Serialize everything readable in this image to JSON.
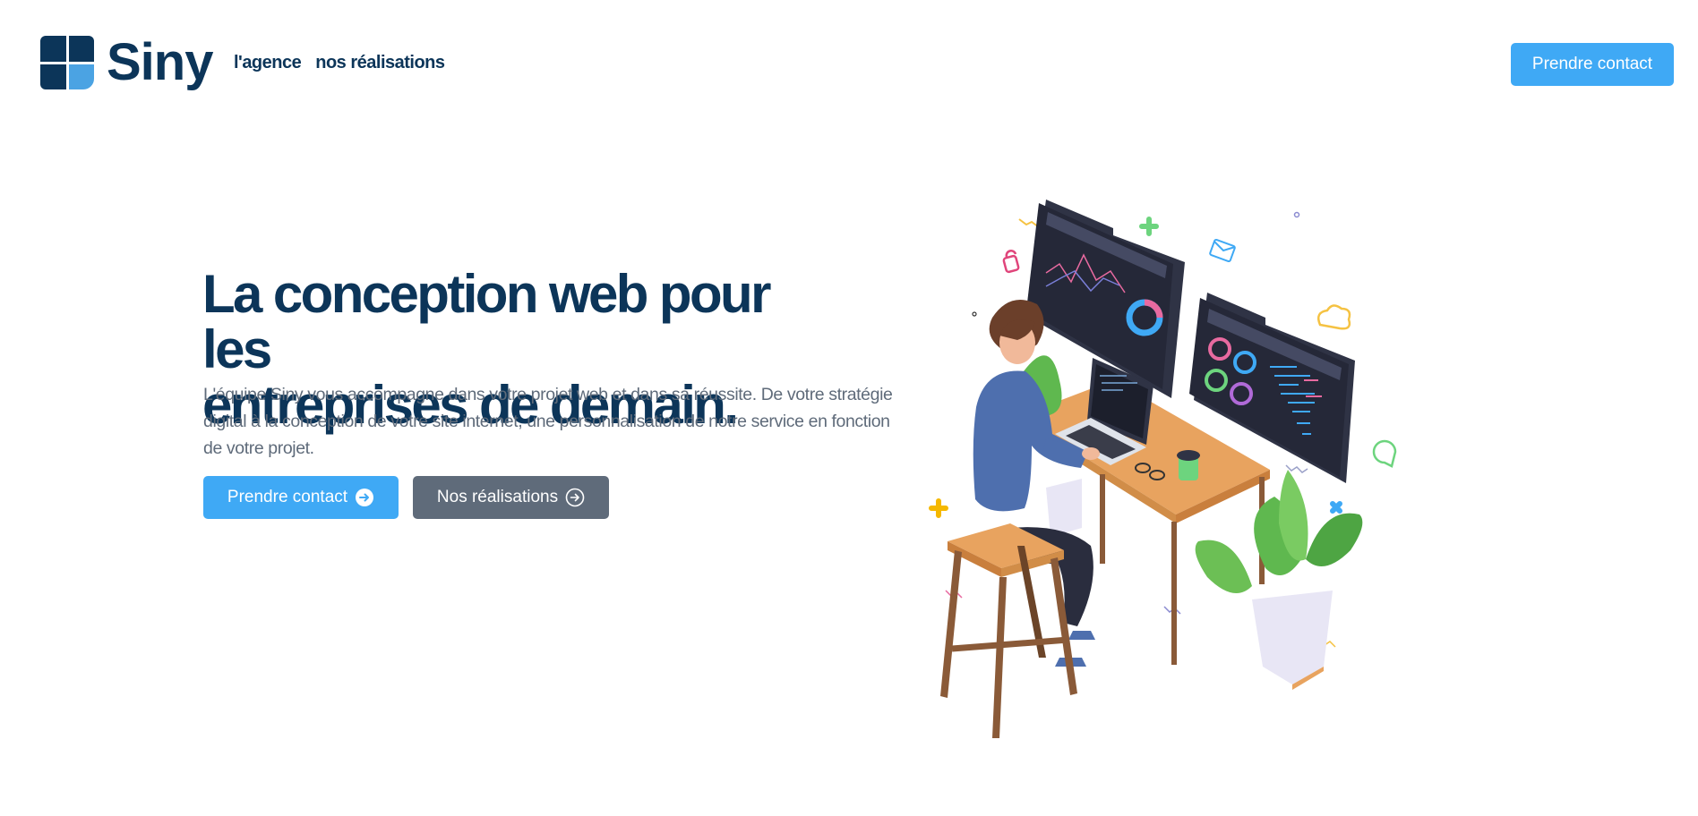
{
  "header": {
    "brand": "Siny",
    "nav": [
      "l'agence",
      "nos réalisations"
    ],
    "cta_label": "Prendre contact"
  },
  "hero": {
    "title_line1": "La conception web pour les",
    "title_line2": "entreprises de demain.",
    "description": "L'équipe Siny vous accompagne dans votre projet web et dans sa réussite. De votre stratégie digital à la conception de votre site internet, une personnalisation de notre service en fonction de votre projet.",
    "primary_button": "Prendre contact",
    "secondary_button": "Nos réalisations",
    "button_icon": "arrow-right-circle-icon"
  },
  "colors": {
    "brand_dark": "#0c3559",
    "brand_light": "#4ba3e3",
    "accent": "#3fa9f5",
    "secondary": "#5f6b7a",
    "text_muted": "#5f6b7a"
  },
  "illustration": {
    "subject": "person working at desk with laptop and two floating dashboard screens"
  }
}
